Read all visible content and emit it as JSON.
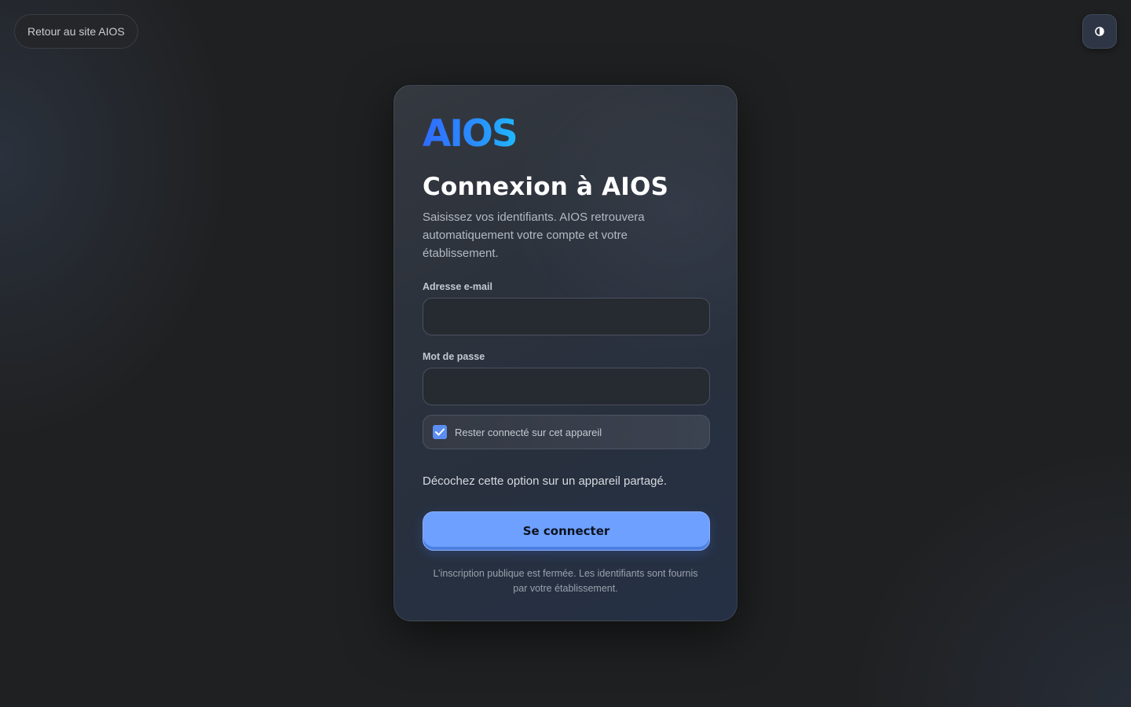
{
  "topbar": {
    "back_label": "Retour au site AIOS",
    "theme_toggle_icon": "half-circle-contrast-icon"
  },
  "card": {
    "logo_text": "AIOS",
    "title": "Connexion à AIOS",
    "subtitle": "Saisissez vos identifiants. AIOS retrouvera automatiquement votre compte et votre établissement.",
    "email": {
      "label": "Adresse e-mail",
      "value": "",
      "placeholder": ""
    },
    "password": {
      "label": "Mot de passe",
      "value": "",
      "placeholder": ""
    },
    "remember": {
      "label": "Rester connecté sur cet appareil",
      "checked": true
    },
    "hint": "Décochez cette option sur un appareil partagé.",
    "submit_label": "Se connecter",
    "footnote": "L’inscription publique est fermée. Les identifiants sont fournis par votre établissement."
  },
  "colors": {
    "background": "#1f2021",
    "accent": "#6ea0ff",
    "logo_gradient_start": "#2f6bff",
    "logo_gradient_end": "#1fb7ff"
  }
}
